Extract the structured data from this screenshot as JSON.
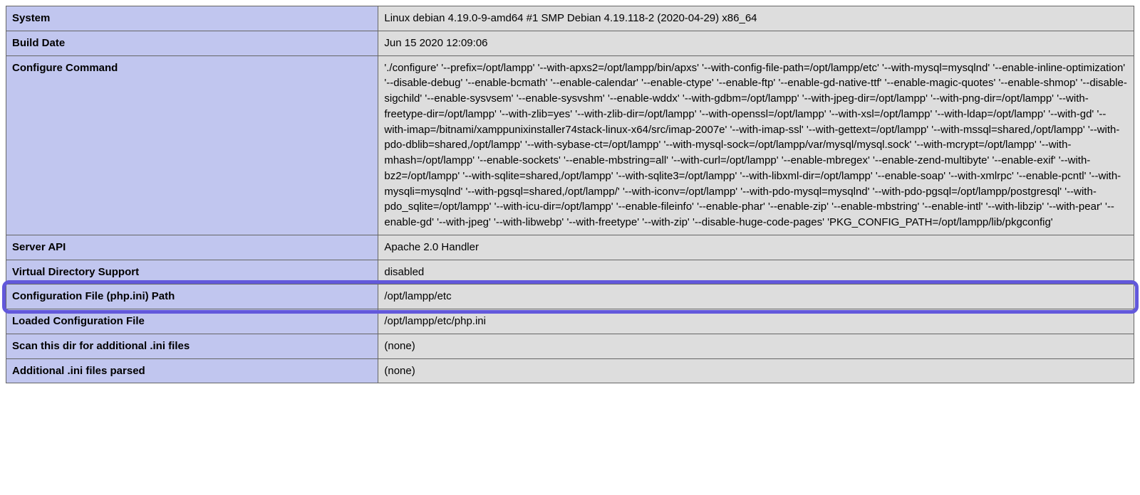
{
  "rows": [
    {
      "label": "System",
      "value": "Linux debian 4.19.0-9-amd64 #1 SMP Debian 4.19.118-2 (2020-04-29) x86_64"
    },
    {
      "label": "Build Date",
      "value": "Jun 15 2020 12:09:06"
    },
    {
      "label": "Configure Command",
      "value": "'./configure' '--prefix=/opt/lampp' '--with-apxs2=/opt/lampp/bin/apxs' '--with-config-file-path=/opt/lampp/etc' '--with-mysql=mysqlnd' '--enable-inline-optimization' '--disable-debug' '--enable-bcmath' '--enable-calendar' '--enable-ctype' '--enable-ftp' '--enable-gd-native-ttf' '--enable-magic-quotes' '--enable-shmop' '--disable-sigchild' '--enable-sysvsem' '--enable-sysvshm' '--enable-wddx' '--with-gdbm=/opt/lampp' '--with-jpeg-dir=/opt/lampp' '--with-png-dir=/opt/lampp' '--with-freetype-dir=/opt/lampp' '--with-zlib=yes' '--with-zlib-dir=/opt/lampp' '--with-openssl=/opt/lampp' '--with-xsl=/opt/lampp' '--with-ldap=/opt/lampp' '--with-gd' '--with-imap=/bitnami/xamppunixinstaller74stack-linux-x64/src/imap-2007e' '--with-imap-ssl' '--with-gettext=/opt/lampp' '--with-mssql=shared,/opt/lampp' '--with-pdo-dblib=shared,/opt/lampp' '--with-sybase-ct=/opt/lampp' '--with-mysql-sock=/opt/lampp/var/mysql/mysql.sock' '--with-mcrypt=/opt/lampp' '--with-mhash=/opt/lampp' '--enable-sockets' '--enable-mbstring=all' '--with-curl=/opt/lampp' '--enable-mbregex' '--enable-zend-multibyte' '--enable-exif' '--with-bz2=/opt/lampp' '--with-sqlite=shared,/opt/lampp' '--with-sqlite3=/opt/lampp' '--with-libxml-dir=/opt/lampp' '--enable-soap' '--with-xmlrpc' '--enable-pcntl' '--with-mysqli=mysqlnd' '--with-pgsql=shared,/opt/lampp/' '--with-iconv=/opt/lampp' '--with-pdo-mysql=mysqlnd' '--with-pdo-pgsql=/opt/lampp/postgresql' '--with-pdo_sqlite=/opt/lampp' '--with-icu-dir=/opt/lampp' '--enable-fileinfo' '--enable-phar' '--enable-zip' '--enable-mbstring' '--enable-intl' '--with-libzip' '--with-pear' '--enable-gd' '--with-jpeg' '--with-libwebp' '--with-freetype' '--with-zip' '--disable-huge-code-pages' 'PKG_CONFIG_PATH=/opt/lampp/lib/pkgconfig'"
    },
    {
      "label": "Server API",
      "value": "Apache 2.0 Handler"
    },
    {
      "label": "Virtual Directory Support",
      "value": "disabled"
    },
    {
      "label": "Configuration File (php.ini) Path",
      "value": "/opt/lampp/etc",
      "highlighted": true
    },
    {
      "label": "Loaded Configuration File",
      "value": "/opt/lampp/etc/php.ini"
    },
    {
      "label": "Scan this dir for additional .ini files",
      "value": "(none)"
    },
    {
      "label": "Additional .ini files parsed",
      "value": "(none)"
    }
  ]
}
